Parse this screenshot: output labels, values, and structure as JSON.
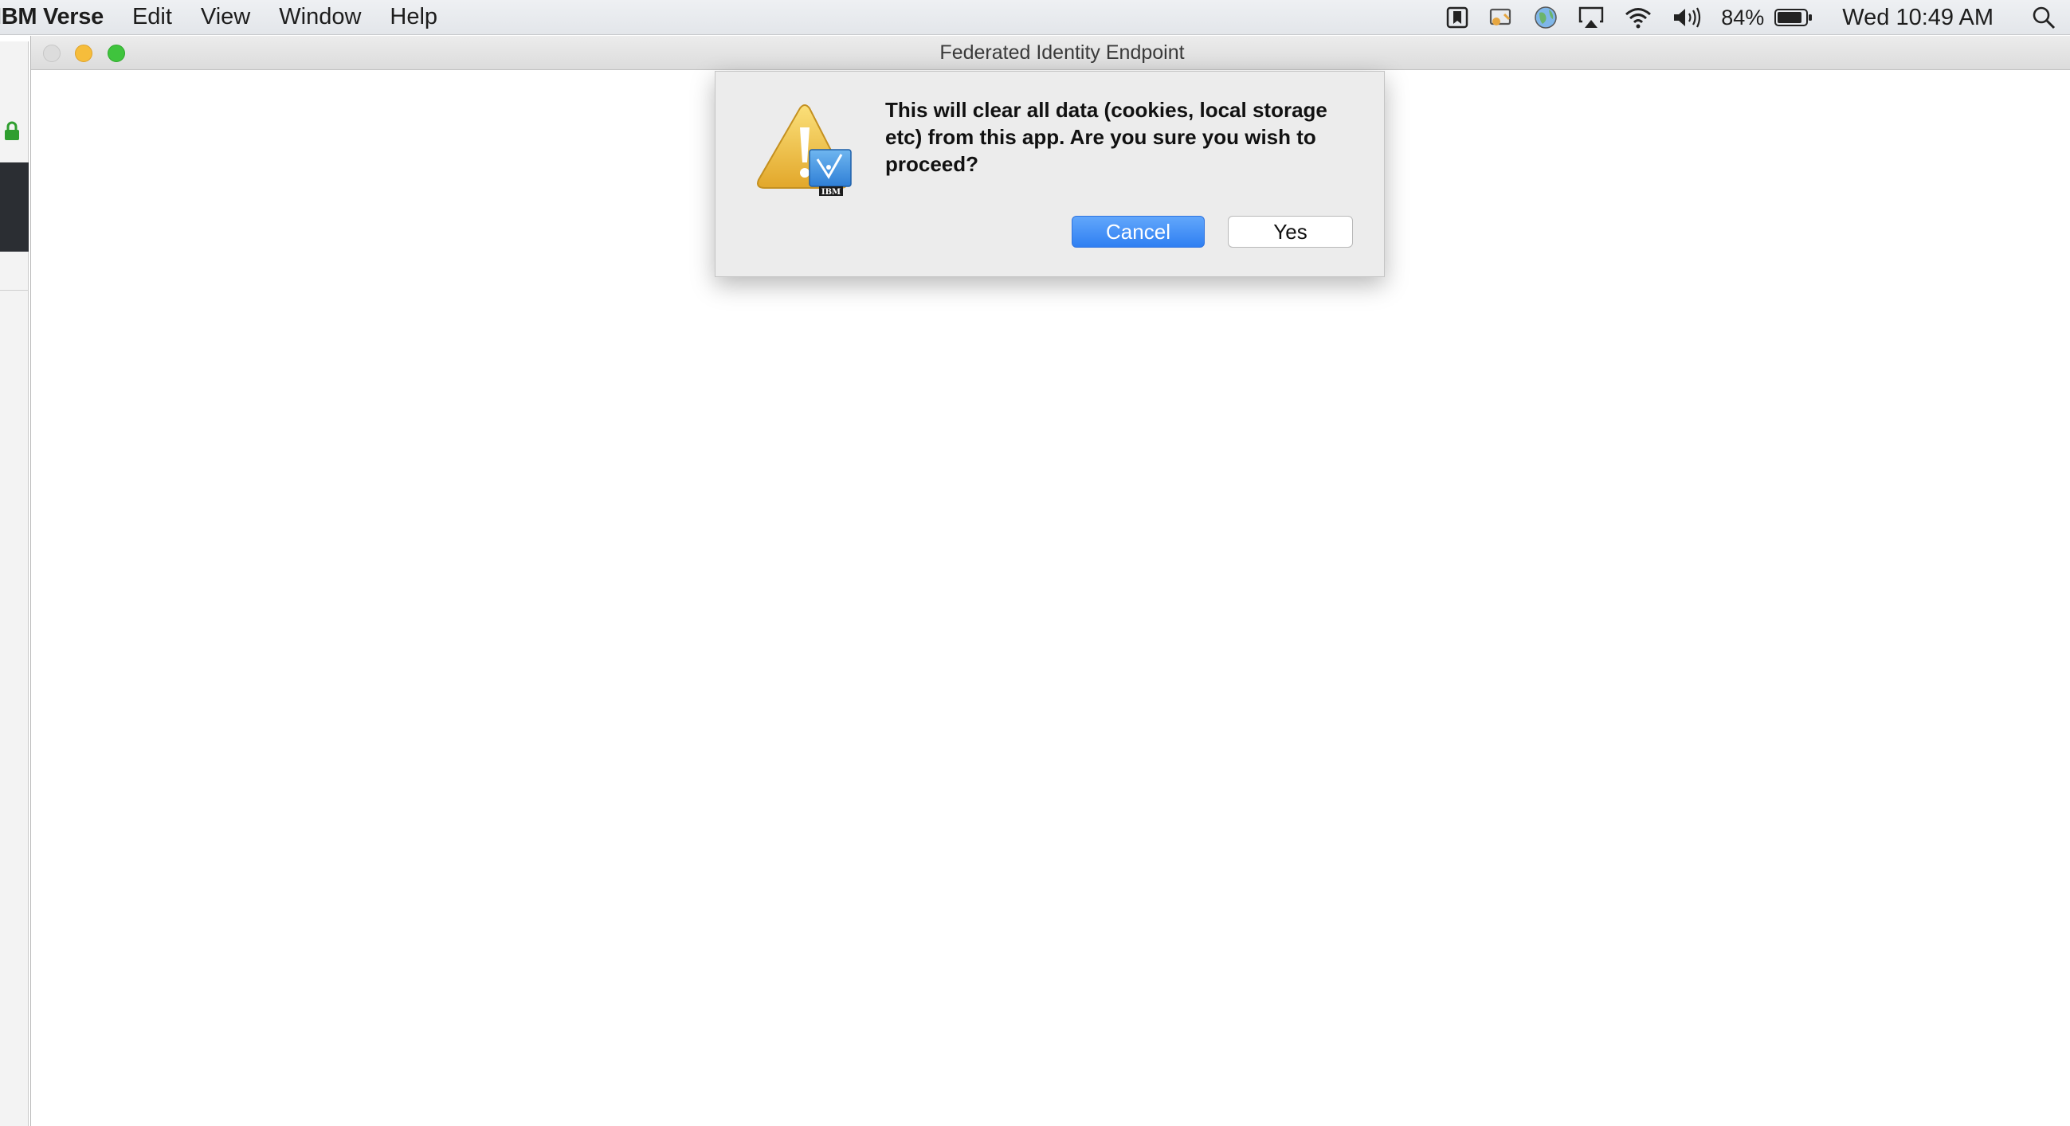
{
  "menubar": {
    "app_name": "IBM Verse",
    "items": [
      "Edit",
      "View",
      "Window",
      "Help"
    ],
    "battery_percent": "84%",
    "clock": "Wed 10:49 AM",
    "status_icons": [
      "bookmark-icon",
      "cast-icon",
      "globe-icon",
      "airplay-icon",
      "wifi-icon",
      "volume-icon",
      "battery-icon",
      "spotlight-search-icon"
    ]
  },
  "window": {
    "title": "Federated Identity Endpoint"
  },
  "dialog": {
    "message": "This will clear all data (cookies, local storage etc) from this app. Are you sure you wish to proceed?",
    "cancel_label": "Cancel",
    "yes_label": "Yes",
    "icon_badge": "IBM",
    "icon": "warning-triangle-icon"
  },
  "colors": {
    "accent": "#2f7ff2",
    "warning": "#f0c23b",
    "traffic_close": "#dcdcdc",
    "traffic_min": "#f6bd3b",
    "traffic_max": "#3fc43d",
    "lock": "#2f9e2f"
  }
}
